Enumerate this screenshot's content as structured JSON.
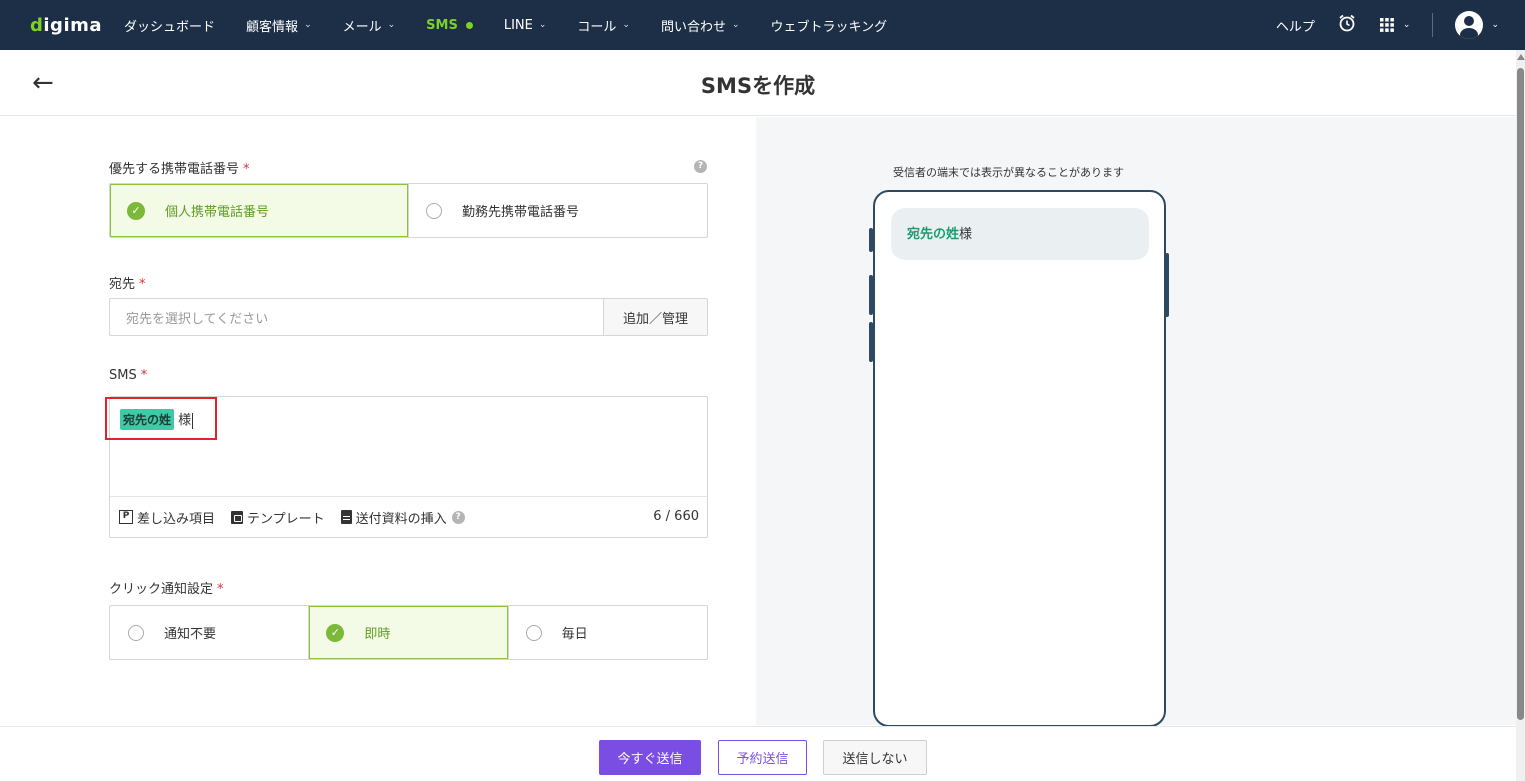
{
  "nav": {
    "logo_prefix": "d",
    "logo_rest": "igima",
    "items": [
      {
        "label": "ダッシュボード",
        "dropdown": false
      },
      {
        "label": "顧客情報",
        "dropdown": true
      },
      {
        "label": "メール",
        "dropdown": true
      },
      {
        "label": "SMS",
        "dropdown": false,
        "active": true
      },
      {
        "label": "LINE",
        "dropdown": true
      },
      {
        "label": "コール",
        "dropdown": true
      },
      {
        "label": "問い合わせ",
        "dropdown": true
      },
      {
        "label": "ウェブトラッキング",
        "dropdown": false
      }
    ],
    "help": "ヘルプ",
    "chevron": "⌄"
  },
  "header": {
    "title": "SMSを作成",
    "back_icon": "←"
  },
  "form": {
    "phone_label": "優先する携帯電話番号",
    "required_mark": "*",
    "help_mark": "?",
    "phone_options": [
      "個人携帯電話番号",
      "勤務先携帯電話番号"
    ],
    "phone_selected_index": 0,
    "to_label": "宛先",
    "to_placeholder": "宛先を選択してください",
    "to_button": "追加／管理",
    "sms_label": "SMS",
    "sms_tag": "宛先の姓",
    "sms_text": "様",
    "tools": {
      "merge_icon": "P",
      "merge": "差し込み項目",
      "template": "テンプレート",
      "attach": "送付資料の挿入"
    },
    "counter": "6 / 660",
    "notify_label": "クリック通知設定",
    "notify_options": [
      "通知不要",
      "即時",
      "毎日"
    ],
    "notify_selected_index": 1
  },
  "preview": {
    "note": "受信者の端末では表示が異なることがあります",
    "var": "宛先の姓",
    "text": "様"
  },
  "footer": {
    "send_now": "今すぐ送信",
    "schedule": "予約送信",
    "dont_send": "送信しない"
  },
  "colors": {
    "nav_bg": "#1c2f47",
    "accent_green": "#7ed321",
    "primary_purple": "#7b4ee3",
    "tag_teal": "#3ec9a7",
    "highlight_red": "#e0242e"
  }
}
